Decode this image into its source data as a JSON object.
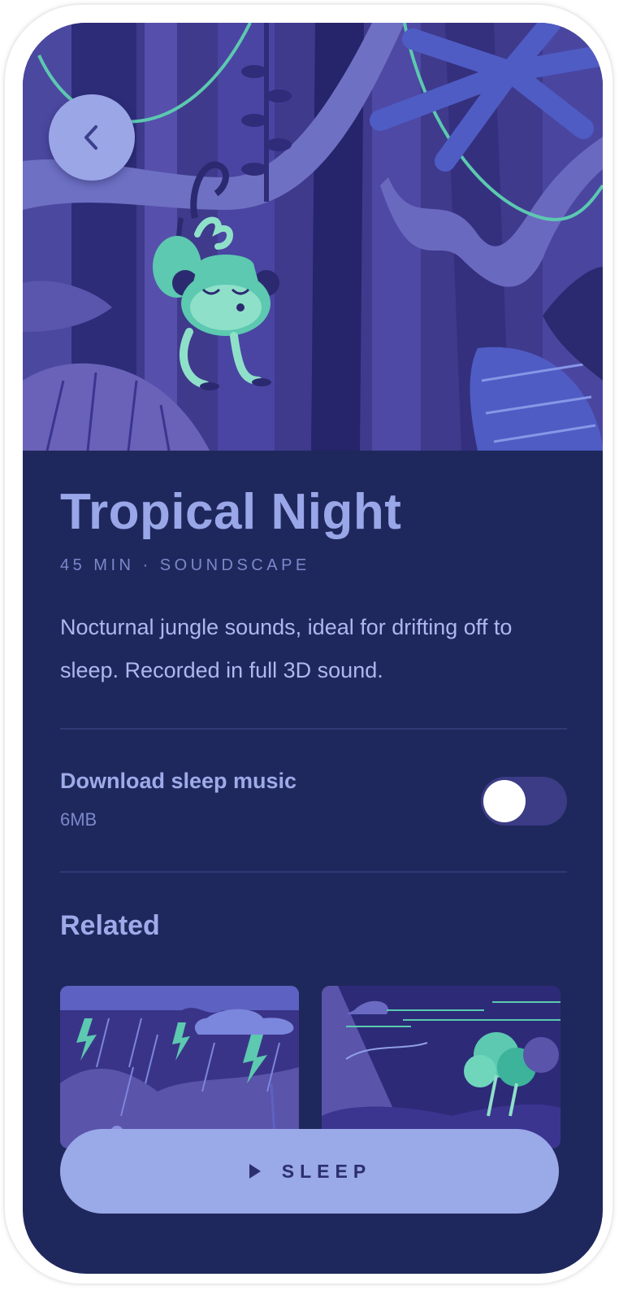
{
  "header": {
    "back_icon": "chevron-left-icon",
    "hero_illustration": "sleeping-monkey-jungle-night"
  },
  "detail": {
    "title": "Tropical Night",
    "meta": "45 MIN · SOUNDSCAPE",
    "description": "Nocturnal jungle sounds, ideal for drifting off to sleep. Recorded in full 3D sound."
  },
  "download": {
    "label": "Download sleep music",
    "size": "6MB",
    "enabled": false
  },
  "related": {
    "heading": "Related",
    "cards": [
      {
        "illustration": "storm-rain-lightning"
      },
      {
        "illustration": "windy-trees-night"
      }
    ]
  },
  "action": {
    "play_icon": "play-icon",
    "label": "SLEEP"
  },
  "colors": {
    "background": "#1f285c",
    "accent": "#9aa9e8",
    "title": "#99a6e8",
    "muted": "#7c88cc",
    "teal": "#5cc9b0"
  }
}
